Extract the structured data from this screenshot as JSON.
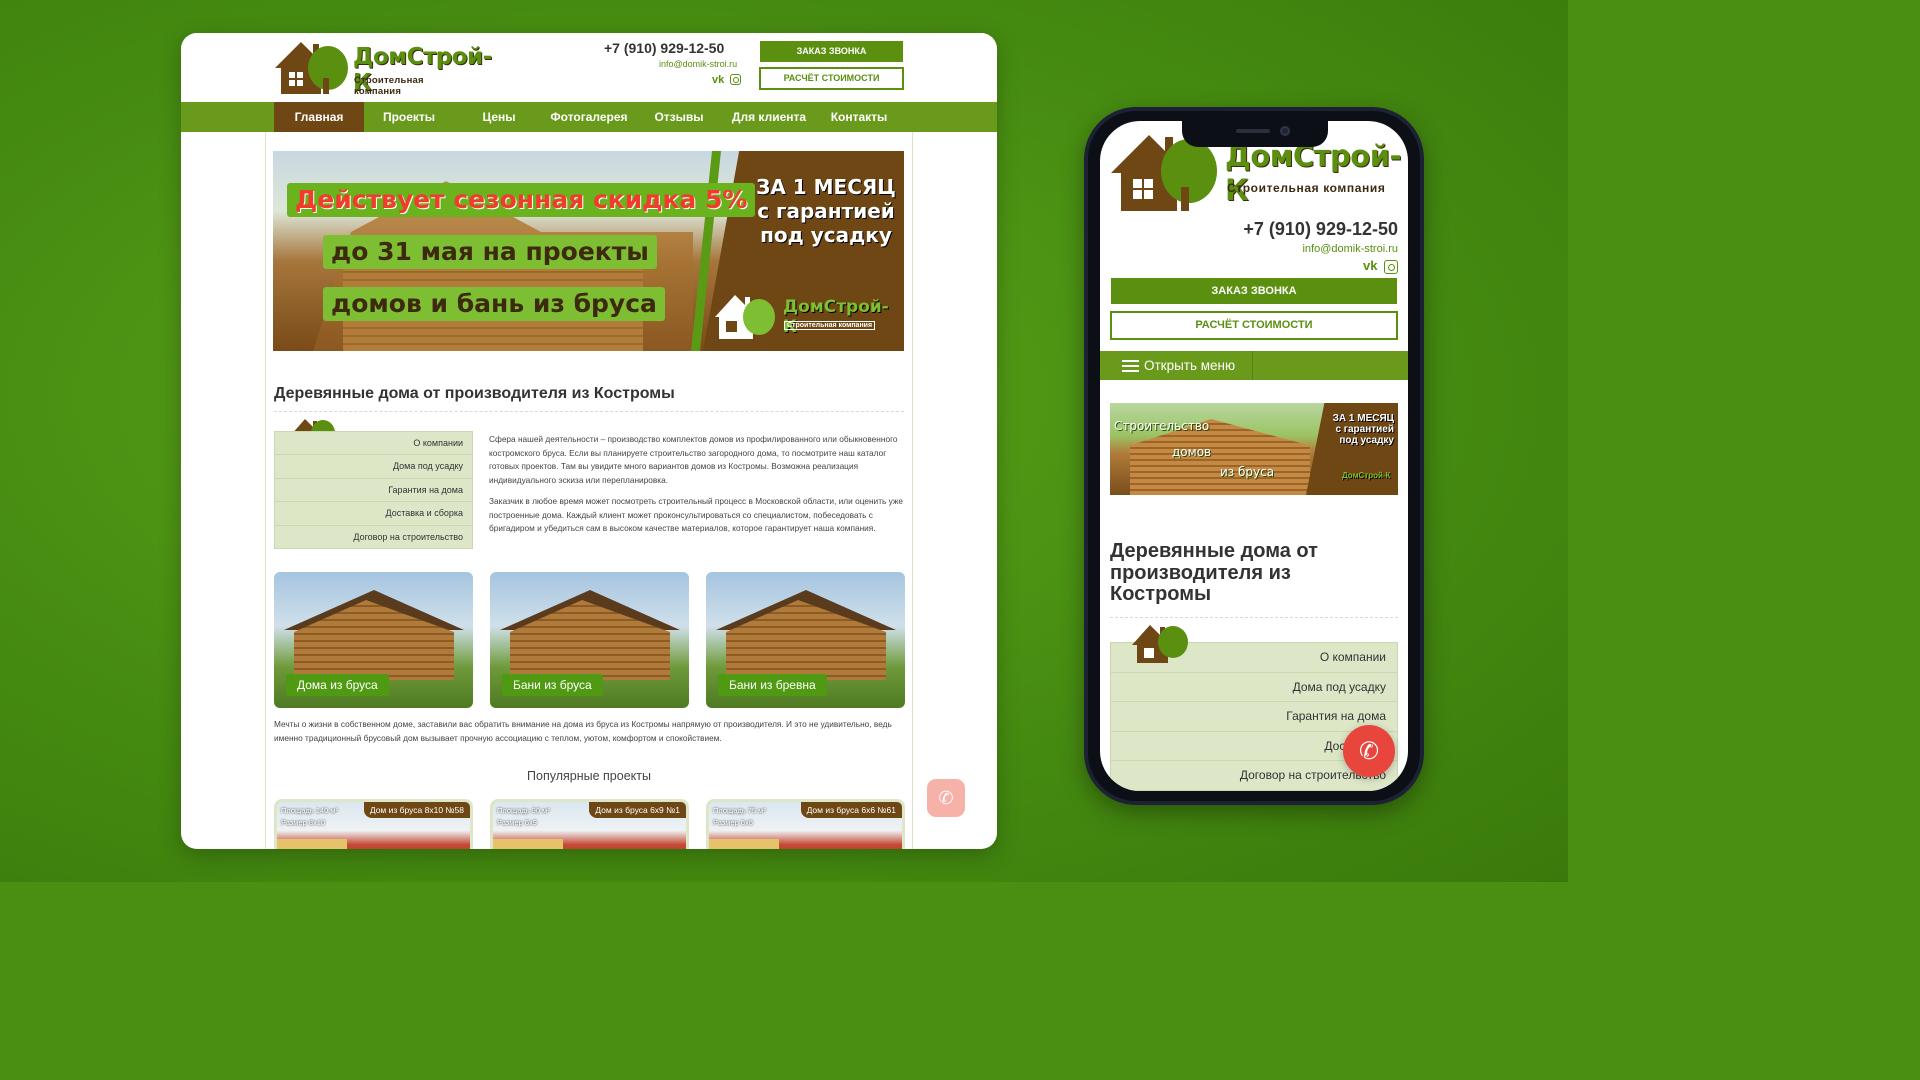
{
  "brand": {
    "name": "ДомСтрой-К",
    "tagline": "Строительная компания",
    "colors": {
      "green": "#5a8f10",
      "brown": "#6e4714",
      "nav_green": "#6a9a1c",
      "light_green": "#dde7c8",
      "call_red": "#e8453c"
    }
  },
  "contacts": {
    "phone": "+7 (910) 929-12-50",
    "email": "info@domik-stroi.ru",
    "social": [
      "vk-icon",
      "instagram-icon"
    ]
  },
  "buttons": {
    "call": "ЗАКАЗ ЗВОНКА",
    "calc": "РАСЧЁТ СТОИМОСТИ"
  },
  "nav": {
    "items": [
      "Главная",
      "Проекты",
      "Цены",
      "Фотогалерея",
      "Отзывы",
      "Для клиента",
      "Контакты"
    ],
    "active": "Главная",
    "mobile_toggle": "Открыть меню"
  },
  "banner": {
    "line1": "Действует сезонная скидка 5%",
    "line2": "до 31 мая на проекты",
    "line3": "домов и бань из бруса",
    "right_text": "ЗА 1 МЕСЯЦ с гарантией под усадку",
    "logo_name": "ДомСтрой-К",
    "logo_sub": "Строительная компания"
  },
  "mobile_banner": {
    "t1": "Строительство",
    "t2": "домов",
    "t3": "из бруса",
    "right_text": "ЗА 1 МЕСЯЦ с гарантией под усадку",
    "logo_name": "ДомСтрой-К"
  },
  "main": {
    "heading": "Деревянные дома от производителя из Костромы",
    "sidebar": [
      "О компании",
      "Дома под усадку",
      "Гарантия на дома",
      "Доставка и сборка",
      "Договор на строительство"
    ],
    "mobile_sidebar": [
      "О компании",
      "Дома под усадку",
      "Гарантия на дома",
      "Доставка и",
      "Договор на строительство"
    ],
    "paragraph1": "Сфера нашей деятельности – производство комплектов домов из профилированного или обыкновенного костромского бруса. Если вы планируете строительство загородного дома, то посмотрите наш каталог готовых проектов. Там вы увидите много вариантов домов из Костромы. Возможна реализация индивидуального эскиза или перепланировка.",
    "paragraph2": "Заказчик в любое время может посмотреть строительный процесс в Московской области, или оценить уже построенные дома. Каждый клиент может проконсультироваться со специалистом, побеседовать с бригадиром и убедиться сам в высоком качестве материалов, которое гарантирует наша компания.",
    "categories": [
      "Дома из бруса",
      "Бани из бруса",
      "Бани из бревна"
    ],
    "paragraph3": "Мечты о жизни в собственном доме, заставили вас обратить внимание на дома из бруса из Костромы напрямую от производителя. И это не удивительно, ведь именно традиционный брусовый дом вызывает прочную ассоциацию с теплом, уютом, комфортом и спокойствием.",
    "popular_title": "Популярные проекты",
    "projects": [
      {
        "area": "Площадь 140 м²",
        "size": "Размер 8х10",
        "name": "Дом из бруса 8х10 №58"
      },
      {
        "area": "Площадь 90 м²",
        "size": "Размер 6х9",
        "name": "Дом из бруса 6х9 №1"
      },
      {
        "area": "Площадь 75 м²",
        "size": "Размер 6х6",
        "name": "Дом из бруса 6х6 №61"
      }
    ]
  }
}
